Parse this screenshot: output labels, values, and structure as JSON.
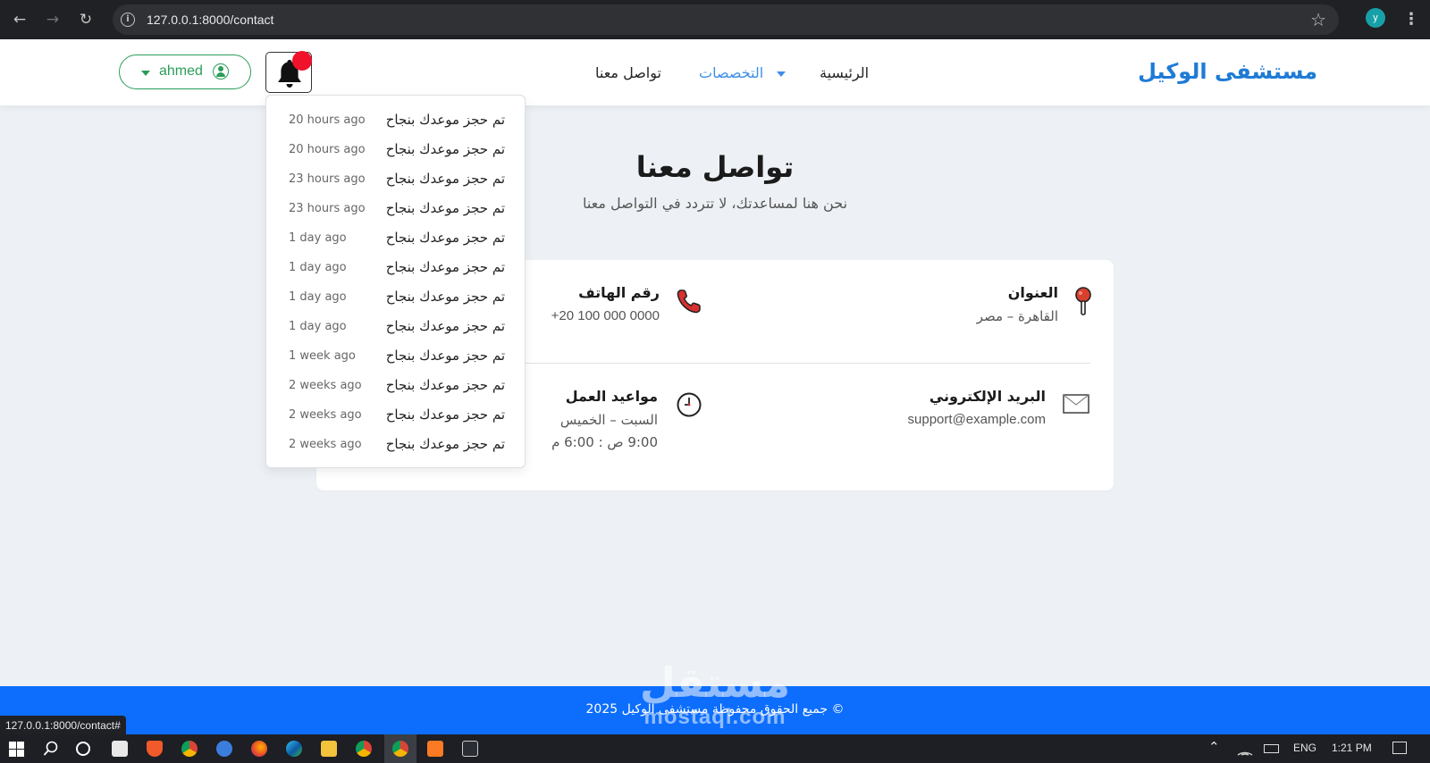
{
  "browser": {
    "url": "127.0.0.1:8000/contact",
    "profile_initial": "y",
    "status_url": "127.0.0.1:8000/contact#"
  },
  "navbar": {
    "brand": "مستشفى الوكيل",
    "links": [
      {
        "label": "الرئيسية"
      },
      {
        "label": "التخصصات",
        "active": true
      },
      {
        "label": "تواصل معنا"
      }
    ],
    "user_name": "ahmed",
    "notification_dot_color": "#f0122a"
  },
  "notifications": [
    {
      "message": "تم حجز موعدك بنجاح",
      "time": "20 hours ago"
    },
    {
      "message": "تم حجز موعدك بنجاح",
      "time": "20 hours ago"
    },
    {
      "message": "تم حجز موعدك بنجاح",
      "time": "23 hours ago"
    },
    {
      "message": "تم حجز موعدك بنجاح",
      "time": "23 hours ago"
    },
    {
      "message": "تم حجز موعدك بنجاح",
      "time": "1 day ago"
    },
    {
      "message": "تم حجز موعدك بنجاح",
      "time": "1 day ago"
    },
    {
      "message": "تم حجز موعدك بنجاح",
      "time": "1 day ago"
    },
    {
      "message": "تم حجز موعدك بنجاح",
      "time": "1 day ago"
    },
    {
      "message": "تم حجز موعدك بنجاح",
      "time": "1 week ago"
    },
    {
      "message": "تم حجز موعدك بنجاح",
      "time": "2 weeks ago"
    },
    {
      "message": "تم حجز موعدك بنجاح",
      "time": "2 weeks ago"
    },
    {
      "message": "تم حجز موعدك بنجاح",
      "time": "2 weeks ago"
    }
  ],
  "page": {
    "title": "تواصل معنا",
    "subtitle": "نحن هنا لمساعدتك، لا تتردد في التواصل معنا"
  },
  "contact": {
    "address": {
      "title": "العنوان",
      "value": "القاهرة – مصر"
    },
    "phone": {
      "title": "رقم الهاتف",
      "value": "+20 100 000 0000"
    },
    "email": {
      "title": "البريد الإلكتروني",
      "value": "support@example.com"
    },
    "hours": {
      "title": "مواعيد العمل",
      "days": "السبت – الخميس",
      "time": "9:00 ص : 6:00 م"
    }
  },
  "footer": {
    "copyright": "© جميع الحقوق محفوظة مستشفى الوكيل 2025",
    "watermark_ar": "مستقل",
    "watermark_lat": "mostaql.com"
  },
  "taskbar": {
    "language": "ENG",
    "clock": "1:21 PM"
  },
  "colors": {
    "brand": "#1f7bd6",
    "accent_green": "#2a9d59",
    "footer": "#0d6efd"
  }
}
